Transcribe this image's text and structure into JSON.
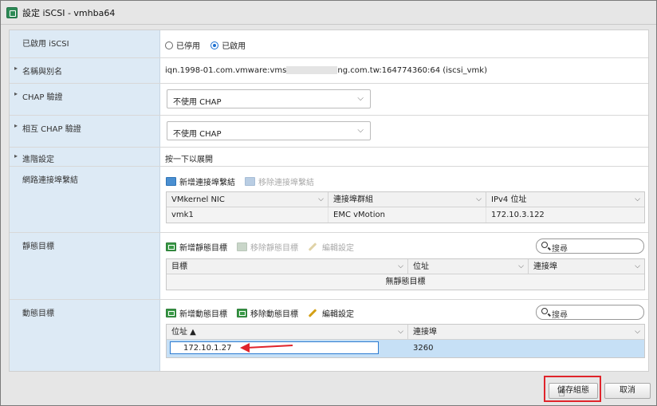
{
  "window": {
    "title": "設定 iSCSI - vmhba64"
  },
  "rows": {
    "enabled": {
      "label": "已啟用 iSCSI",
      "options": [
        "已停用",
        "已啟用"
      ],
      "selected": "已啟用"
    },
    "name_alias": {
      "label": "名稱與別名",
      "value": "iqn.1998-01.com.vmware:vms",
      "value_suffix": "ng.com.tw:164774360:64 (iscsi_vmk)"
    },
    "chap": {
      "label": "CHAP 驗證",
      "selected": "不使用 CHAP"
    },
    "mutual_chap": {
      "label": "相互 CHAP 驗證",
      "selected": "不使用 CHAP"
    },
    "advanced": {
      "label": "進階設定",
      "value": "按一下以展開"
    },
    "network_binding": {
      "label": "網路連接埠繫結",
      "toolbar": {
        "add": "新增連接埠繫結",
        "remove": "移除連接埠繫結"
      },
      "columns": [
        "VMkernel NIC",
        "連接埠群組",
        "IPv4 位址"
      ],
      "rows": [
        [
          "vmk1",
          "EMC vMotion",
          "172.10.3.122"
        ]
      ]
    },
    "static_targets": {
      "label": "靜態目標",
      "toolbar": {
        "add": "新增靜態目標",
        "remove": "移除靜態目標",
        "edit": "編輯設定"
      },
      "search_placeholder": "搜尋",
      "columns": [
        "目標",
        "位址",
        "連接埠"
      ],
      "empty": "無靜態目標"
    },
    "dynamic_targets": {
      "label": "動態目標",
      "toolbar": {
        "add": "新增動態目標",
        "remove": "移除動態目標",
        "edit": "編輯設定"
      },
      "search_placeholder": "搜尋",
      "columns": [
        "位址 ▲",
        "連接埠"
      ],
      "rows": [
        {
          "address": "172.10.1.27",
          "port": "3260"
        }
      ]
    }
  },
  "footer": {
    "save": "儲存組態",
    "cancel": "取消"
  },
  "colors": {
    "label_bg": "#ddeaf5",
    "selected_row": "#c6e0f6",
    "highlight": "#e0242b",
    "accent": "#1b6fd1"
  },
  "icons": [
    "vmhba-app-icon",
    "expand-triangle-icon",
    "chevron-down-icon",
    "add-icon",
    "remove-icon",
    "edit-pencil-icon",
    "search-icon",
    "pointer-cursor-icon",
    "red-arrow-annotation"
  ]
}
